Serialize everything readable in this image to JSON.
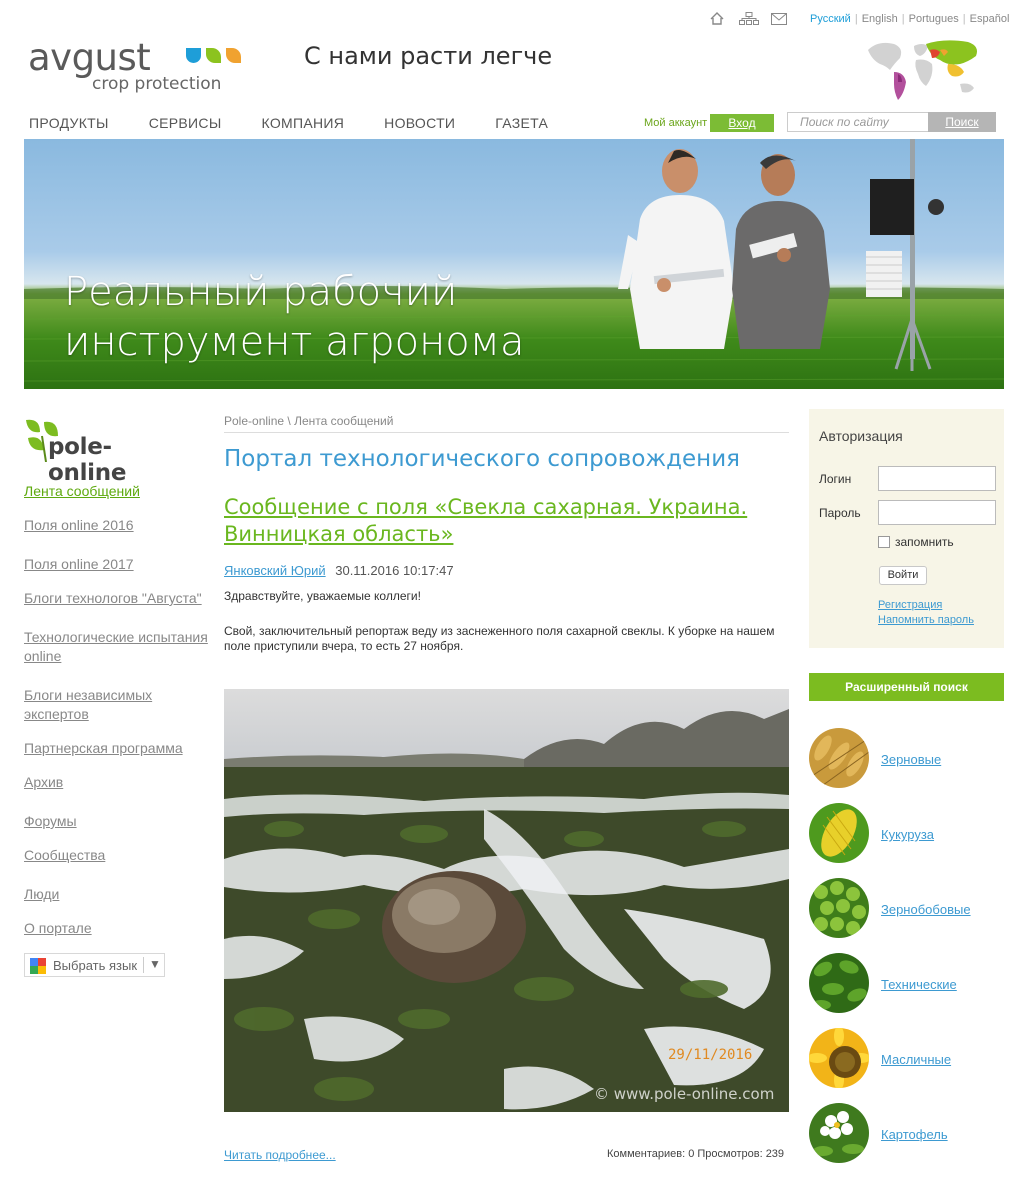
{
  "header": {
    "logo_word": "avgust",
    "logo_sub": "crop protection",
    "slogan": "С нами расти легче",
    "top_icons": [
      "home-icon",
      "sitemap-icon",
      "mail-icon"
    ],
    "languages": [
      {
        "label": "Русский",
        "active": true
      },
      {
        "label": "English",
        "active": false
      },
      {
        "label": "Portugues",
        "active": false
      },
      {
        "label": "Español",
        "active": false
      }
    ],
    "nav": [
      "ПРОДУКТЫ",
      "СЕРВИСЫ",
      "КОМПАНИЯ",
      "НОВОСТИ",
      "ГАЗЕТА"
    ],
    "account_label": "Мой аккаунт",
    "login_label": "Вход",
    "search_placeholder": "Поиск по сайту",
    "search_button": "Поиск"
  },
  "banner": {
    "line1": "Реальный рабочий",
    "line2": "инструмент агронома"
  },
  "sidebar": {
    "logo_text": "pole-online",
    "items": [
      {
        "label": "Лента сообщений",
        "active": true
      },
      {
        "label": "Поля online 2016",
        "active": false
      },
      {
        "label": "Поля online 2017",
        "active": false
      },
      {
        "label": "Блоги технологов \"Августа\"",
        "active": false
      },
      {
        "label": "Технологические испытания online",
        "active": false
      },
      {
        "label": "Блоги независимых экспертов",
        "active": false
      },
      {
        "label": "Партнерская программа",
        "active": false
      },
      {
        "label": "Архив",
        "active": false
      },
      {
        "label": "Форумы",
        "active": false
      },
      {
        "label": "Сообщества",
        "active": false
      },
      {
        "label": "Люди",
        "active": false
      },
      {
        "label": "О портале",
        "active": false
      }
    ],
    "language_select": "Выбрать язык"
  },
  "main": {
    "breadcrumb": [
      "Pole-online",
      "Лента сообщений"
    ],
    "breadcrumb_sep": " \\ ",
    "portal_title": "Портал технологического сопровождения",
    "post": {
      "title": "Сообщение с поля «Свекла сахарная. Украина. Винницкая область»",
      "author": "Янковский Юрий",
      "datetime": "30.11.2016 10:17:47",
      "greeting": "Здравствуйте, уважаемые коллеги!",
      "body": "Свой, заключительный репортаж веду из заснеженного поля сахарной свеклы. К уборке  на нашем поле приступили вчера, то есть   27 ноября.",
      "photo_date": "29/11/2016",
      "photo_watermark": "© www.pole-online.com",
      "read_more": "Читать подробнее...",
      "stats": "Комментариев: 0 Просмотров: 239"
    }
  },
  "auth": {
    "title": "Авторизация",
    "login_label": "Логин",
    "password_label": "Пароль",
    "remember_label": "запомнить",
    "submit_label": "Войти",
    "register_link": "Регистрация",
    "remind_link": "Напомнить пароль"
  },
  "advanced_search": "Расширенный поиск",
  "categories": [
    {
      "label": "Зерновые",
      "icon": "grain-icon"
    },
    {
      "label": "Кукуруза",
      "icon": "corn-icon"
    },
    {
      "label": "Зернобобовые",
      "icon": "peas-icon"
    },
    {
      "label": "Технические",
      "icon": "sugarbeet-icon"
    },
    {
      "label": "Масличные",
      "icon": "sunflower-icon"
    },
    {
      "label": "Картофель",
      "icon": "potato-flower-icon"
    }
  ],
  "colors": {
    "brand_green": "#7cbc20",
    "link_blue": "#3d9ad1",
    "title_green": "#6ab71f",
    "auth_bg": "#f7f5e7"
  }
}
